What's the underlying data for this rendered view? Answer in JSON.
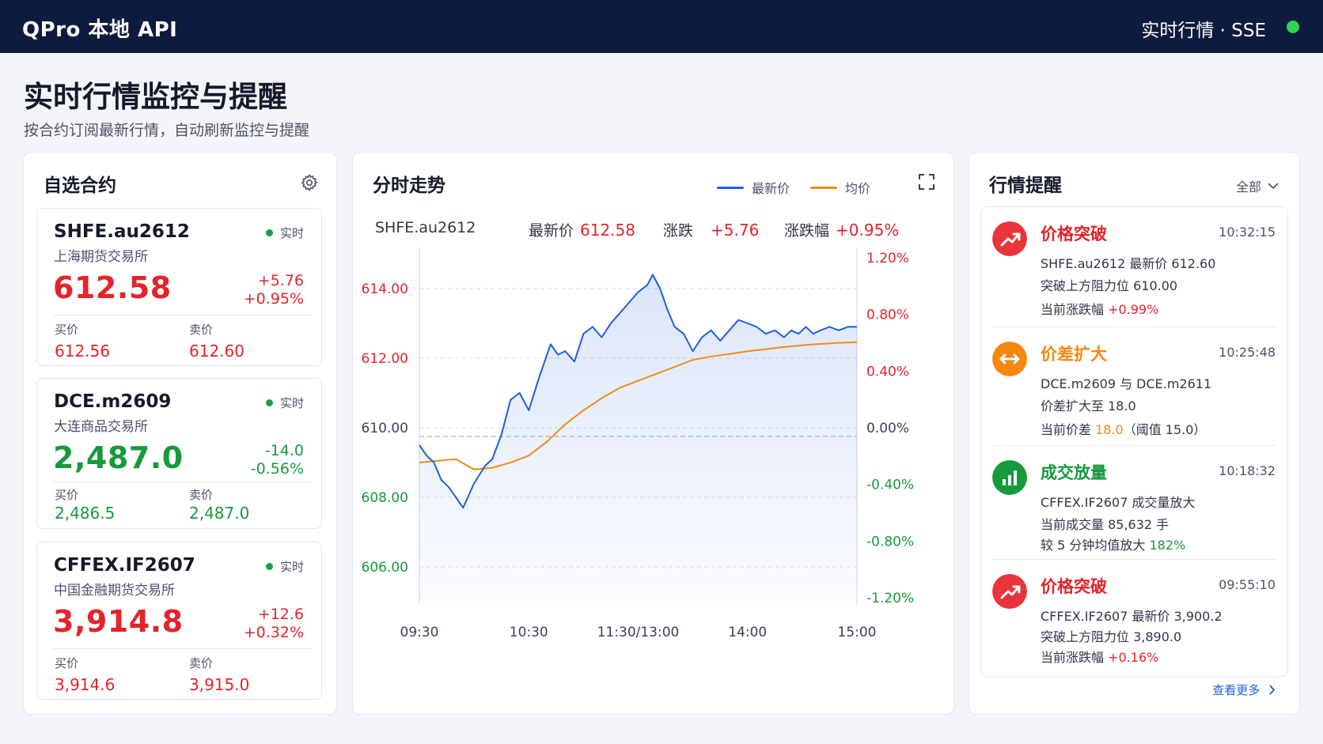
{
  "header": {
    "app_title": "QPro 本地 API",
    "status": "实时行情 · SSE"
  },
  "page": {
    "title": "实时行情监控与提醒",
    "subtitle": "按合约订阅最新行情，自动刷新监控与提醒"
  },
  "watchlist": {
    "title": "自选合约",
    "live_label": "实时",
    "bid_label": "买价",
    "ask_label": "卖价",
    "items": [
      {
        "symbol": "SHFE.au2612",
        "exchange": "上海期货交易所",
        "price": "612.58",
        "change": "+5.76",
        "change_pct": "+0.95%",
        "bid": "612.56",
        "ask": "612.60",
        "direction": "up"
      },
      {
        "symbol": "DCE.m2609",
        "exchange": "大连商品交易所",
        "price": "2,487.0",
        "change": "-14.0",
        "change_pct": "-0.56%",
        "bid": "2,486.5",
        "ask": "2,487.0",
        "direction": "down"
      },
      {
        "symbol": "CFFEX.IF2607",
        "exchange": "中国金融期货交易所",
        "price": "3,914.8",
        "change": "+12.6",
        "change_pct": "+0.32%",
        "bid": "3,914.6",
        "ask": "3,915.0",
        "direction": "up"
      }
    ]
  },
  "chart_panel": {
    "title": "分时走势",
    "legend_last": "最新价",
    "legend_avg": "均价",
    "symbol": "SHFE.au2612",
    "last_label": "最新价",
    "last_value": "612.58",
    "change_label": "涨跌",
    "change_value": "+5.76",
    "pct_label": "涨跌幅",
    "pct_value": "+0.95%"
  },
  "chart_data": {
    "type": "line",
    "x_ticks": [
      "09:30",
      "10:30",
      "11:30/13:00",
      "14:00",
      "15:00"
    ],
    "y_ticks_left": [
      "614.00",
      "612.00",
      "610.00",
      "608.00",
      "606.00"
    ],
    "y_ticks_right": [
      "1.20%",
      "0.80%",
      "0.40%",
      "0.00%",
      "-0.40%",
      "-0.80%",
      "-1.20%"
    ],
    "ylim": [
      605.0,
      615.0
    ],
    "baseline": 609.75,
    "series": [
      {
        "name": "最新价",
        "color": "#1f5fe0",
        "x": [
          0,
          4,
          8,
          12,
          16,
          20,
          24,
          30,
          36,
          40,
          45,
          50,
          55,
          60,
          66,
          72,
          76,
          80,
          85,
          90,
          95,
          100,
          105,
          110,
          115,
          120,
          125,
          128,
          132,
          136,
          140,
          145,
          150,
          155,
          160,
          165,
          170,
          175,
          180,
          185,
          190,
          195,
          200,
          204,
          208,
          212,
          216,
          220,
          225,
          230,
          235,
          240
        ],
        "values": [
          609.5,
          609.2,
          609.0,
          608.5,
          608.3,
          608.0,
          607.7,
          608.4,
          608.9,
          609.1,
          609.8,
          610.8,
          611.0,
          610.5,
          611.5,
          612.4,
          612.1,
          612.2,
          611.9,
          612.7,
          612.9,
          612.6,
          613.0,
          613.3,
          613.6,
          613.9,
          614.1,
          614.4,
          614.0,
          613.4,
          612.9,
          612.7,
          612.2,
          612.6,
          612.8,
          612.5,
          612.8,
          613.1,
          613.0,
          612.9,
          612.7,
          612.8,
          612.6,
          612.8,
          612.7,
          612.9,
          612.7,
          612.8,
          612.9,
          612.8,
          612.9,
          612.9
        ]
      },
      {
        "name": "均价",
        "color": "#f28a1b",
        "x": [
          0,
          20,
          30,
          40,
          50,
          60,
          70,
          80,
          90,
          100,
          110,
          120,
          130,
          140,
          150,
          160,
          170,
          180,
          190,
          200,
          210,
          220,
          230,
          240
        ],
        "values": [
          609.0,
          609.1,
          608.8,
          608.85,
          609.0,
          609.2,
          609.6,
          610.1,
          610.5,
          610.85,
          611.15,
          611.35,
          611.55,
          611.75,
          611.95,
          612.05,
          612.12,
          612.2,
          612.26,
          612.32,
          612.37,
          612.41,
          612.44,
          612.46
        ]
      }
    ]
  },
  "alerts": {
    "title": "行情提醒",
    "filter_label": "全部",
    "more_label": "查看更多",
    "items": [
      {
        "title": "价格突破",
        "time": "10:32:15",
        "icon": "trend-up-icon",
        "color": "#e8343a",
        "line1": "SHFE.au2612  最新价 612.60",
        "line2": "突破上方阻力位  610.00",
        "line3_label": "当前涨跌幅 ",
        "line3_value": "+0.99%",
        "line3_color": "#e3242b",
        "line3_suffix": ""
      },
      {
        "title": "价差扩大",
        "time": "10:25:48",
        "icon": "double-arrow-icon",
        "color": "#f5870f",
        "line1": "DCE.m2609 与 DCE.m2611",
        "line2": "价差扩大至  18.0",
        "line3_label": "当前价差 ",
        "line3_value": "18.0",
        "line3_color": "#f5870f",
        "line3_suffix": "（阈值 15.0）"
      },
      {
        "title": "成交放量",
        "time": "10:18:32",
        "icon": "bar-chart-icon",
        "color": "#179a3c",
        "line1": "CFFEX.IF2607  成交量放大",
        "line2": "当前成交量 85,632  手",
        "line3_label": "较 5 分钟均值放大 ",
        "line3_value": "182%",
        "line3_color": "#179a3c",
        "line3_suffix": ""
      },
      {
        "title": "价格突破",
        "time": "09:55:10",
        "icon": "trend-up-icon",
        "color": "#e8343a",
        "line1": "CFFEX.IF2607  最新价 3,900.2",
        "line2": "突破上方阻力位  3,890.0",
        "line3_label": "当前涨跌幅 ",
        "line3_value": "+0.16%",
        "line3_color": "#e3242b",
        "line3_suffix": ""
      }
    ]
  },
  "colors": {
    "up": "#e3242b",
    "down": "#179a3c",
    "header_bg": "#0d1b3e",
    "live_dot": "#2fd35a",
    "accent": "#1d5fd6"
  }
}
